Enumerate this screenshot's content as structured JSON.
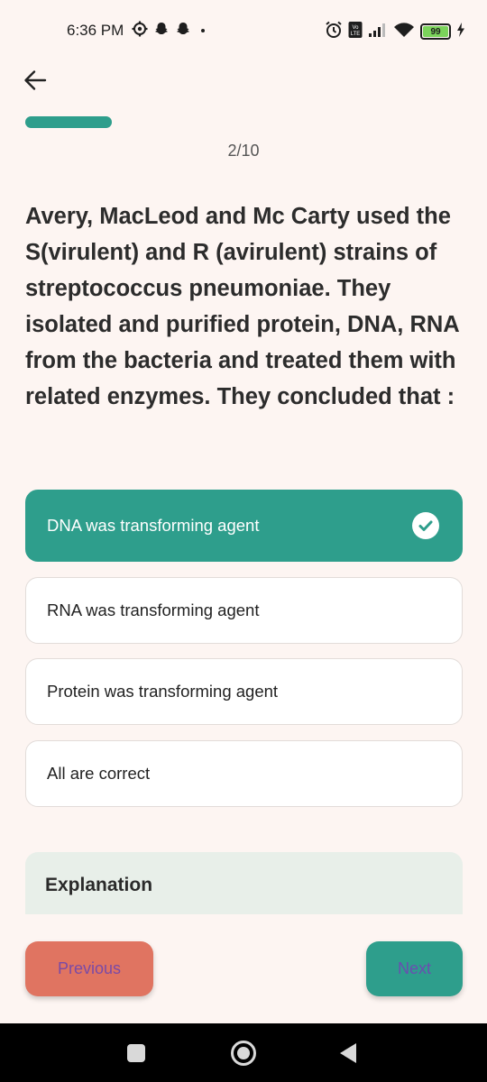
{
  "status_bar": {
    "time": "6:36 PM",
    "icons_left": [
      "settings-gear-icon",
      "snapchat-icon",
      "snapchat-icon",
      "dot-icon"
    ],
    "icons_right": [
      "alarm-icon",
      "volte-icon",
      "signal-icon",
      "wifi-icon",
      "battery-icon",
      "charging-icon"
    ],
    "battery_level": "99"
  },
  "header": {
    "back_icon": "arrow-left-icon"
  },
  "progress": {
    "counter": "2/10",
    "fill_color": "#2e9e8c"
  },
  "question": {
    "text": "Avery, MacLeod and Mc Carty used the S(virulent) and R (avirulent) strains of streptococcus pneumoniae. They isolated and purified protein, DNA, RNA from the bacteria and treated them with related enzymes. They concluded that :"
  },
  "options": [
    {
      "label": "DNA was transforming agent",
      "selected": true
    },
    {
      "label": "RNA was transforming agent",
      "selected": false
    },
    {
      "label": "Protein was transforming agent",
      "selected": false
    },
    {
      "label": "All are correct",
      "selected": false
    }
  ],
  "explanation": {
    "title": "Explanation"
  },
  "footer": {
    "previous_label": "Previous",
    "next_label": "Next"
  },
  "colors": {
    "accent": "#2e9e8c",
    "previous_button": "#e07461",
    "background": "#fdf5f2"
  }
}
